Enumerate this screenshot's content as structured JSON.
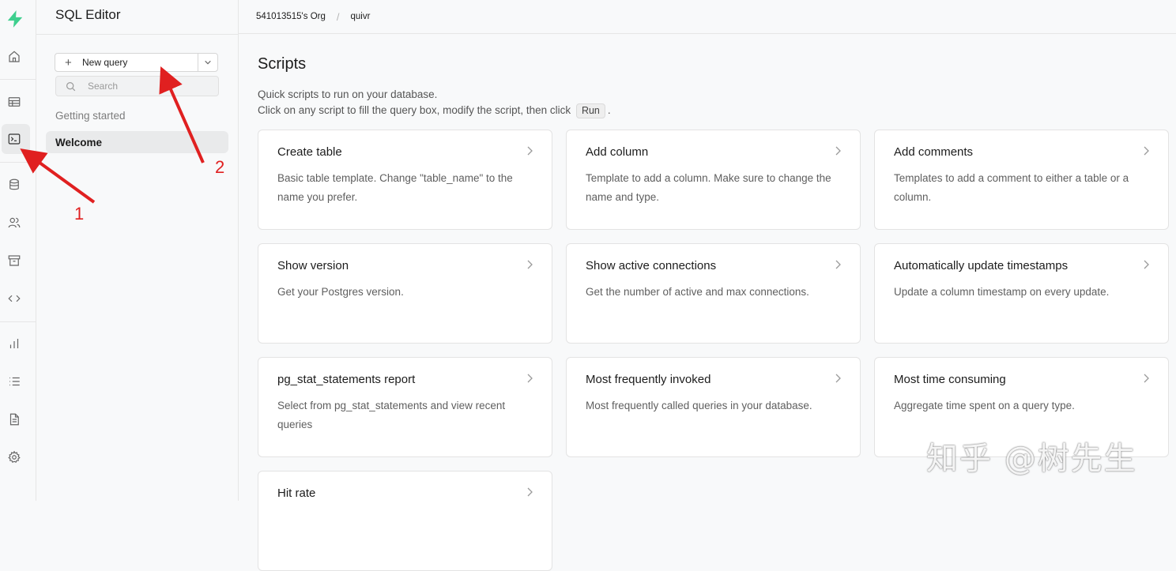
{
  "sidebar": {
    "title": "SQL Editor",
    "new_query_label": "New query",
    "search_placeholder": "Search",
    "section_label": "Getting started",
    "active_item": "Welcome"
  },
  "breadcrumb": {
    "org": "541013515's Org",
    "project": "quivr"
  },
  "main": {
    "heading": "Scripts",
    "desc_line1": "Quick scripts to run on your database.",
    "desc_line2_pre": "Click on any script to fill the query box, modify the script, then click",
    "run_label": "Run",
    "desc_line2_post": "."
  },
  "cards": [
    {
      "title": "Create table",
      "desc": "Basic table template. Change \"table_name\" to the name you prefer."
    },
    {
      "title": "Add column",
      "desc": "Template to add a column. Make sure to change the name and type."
    },
    {
      "title": "Add comments",
      "desc": "Templates to add a comment to either a table or a column."
    },
    {
      "title": "Show version",
      "desc": "Get your Postgres version."
    },
    {
      "title": "Show active connections",
      "desc": "Get the number of active and max connections."
    },
    {
      "title": "Automatically update timestamps",
      "desc": "Update a column timestamp on every update."
    },
    {
      "title": "pg_stat_statements report",
      "desc": "Select from pg_stat_statements and view recent queries"
    },
    {
      "title": "Most frequently invoked",
      "desc": "Most frequently called queries in your database."
    },
    {
      "title": "Most time consuming",
      "desc": "Aggregate time spent on a query type."
    },
    {
      "title": "Hit rate",
      "desc": ""
    }
  ],
  "rail_icons": [
    "home-icon",
    "table-icon",
    "terminal-icon",
    "database-icon",
    "users-icon",
    "archive-icon",
    "code-icon",
    "bar-chart-icon",
    "list-icon",
    "document-icon",
    "settings-icon"
  ],
  "annotations": {
    "label_1": "1",
    "label_2": "2",
    "watermark": "知乎 @树先生"
  },
  "colors": {
    "brand": "#3ecf8e",
    "annotation_red": "#e02020"
  }
}
